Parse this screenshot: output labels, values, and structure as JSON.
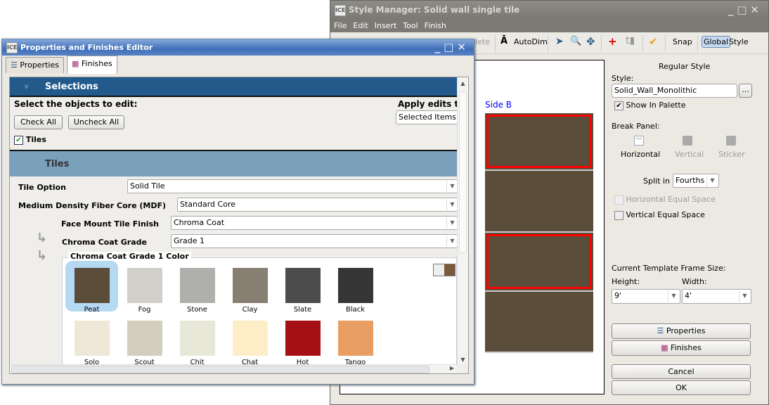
{
  "style_manager": {
    "title": "Style Manager: Solid wall single tile",
    "menu": [
      "File",
      "Edit",
      "Insert",
      "Tool",
      "Finish"
    ],
    "toolbar": {
      "delete_label": "lete",
      "autodim": "AutoDim",
      "snap": "Snap",
      "global": "Global",
      "style": "Style"
    },
    "canvas": {
      "side_label": "Side B",
      "tile_color": "#5a4d3a",
      "selection_color": "#ff0000"
    },
    "panel": {
      "heading": "Regular Style",
      "style_label": "Style:",
      "style_value": "Solid_Wall_Monolithic",
      "browse": "...",
      "show_in_palette": "Show In Palette",
      "break_panel": "Break Panel:",
      "break_options": [
        "Horizontal",
        "Vertical",
        "Sticker"
      ],
      "split_in": "Split in",
      "split_value": "Fourths",
      "horizontal_equal": "Horizontal Equal Space",
      "vertical_equal": "Vertical Equal Space",
      "frame_size": "Current Template Frame Size:",
      "height_label": "Height:",
      "height_value": "9'",
      "width_label": "Width:",
      "width_value": "4'",
      "properties": "Properties",
      "finishes": "Finishes",
      "cancel": "Cancel",
      "ok": "OK"
    }
  },
  "editor": {
    "title": "Properties and Finishes Editor",
    "tabs": [
      "Properties",
      "Finishes"
    ],
    "selections": "Selections",
    "select_objects": "Select the objects to edit:",
    "apply_edits": "Apply edits t",
    "apply_value": "Selected Items",
    "check_all": "Check All",
    "uncheck_all": "Uncheck All",
    "tiles_checkbox": "Tiles",
    "tiles_header": "Tiles",
    "fields": [
      {
        "label": "Tile Option",
        "value": "Solid Tile"
      },
      {
        "label": "Medium Density Fiber Core (MDF)",
        "value": "Standard Core"
      },
      {
        "label": "Face Mount Tile Finish",
        "value": "Chroma Coat"
      },
      {
        "label": "Chroma Coat Grade",
        "value": "Grade 1"
      }
    ],
    "color_group": "Chroma Coat Grade 1 Color",
    "colors": [
      {
        "name": "Peat",
        "hex": "#5a4d3a"
      },
      {
        "name": "Fog",
        "hex": "#d0cfca"
      },
      {
        "name": "Stone",
        "hex": "#afb0ab"
      },
      {
        "name": "Clay",
        "hex": "#877f72"
      },
      {
        "name": "Slate",
        "hex": "#4c4c4c"
      },
      {
        "name": "Black",
        "hex": "#363636"
      },
      {
        "name": "Solo",
        "hex": "#efe8d8"
      },
      {
        "name": "Scout",
        "hex": "#d3cfbe"
      },
      {
        "name": "Chit",
        "hex": "#e7e8d8"
      },
      {
        "name": "Chat",
        "hex": "#fdeec8"
      },
      {
        "name": "Hot",
        "hex": "#a41013"
      },
      {
        "name": "Tango",
        "hex": "#e89e63"
      }
    ],
    "selected_color": "Peat"
  }
}
